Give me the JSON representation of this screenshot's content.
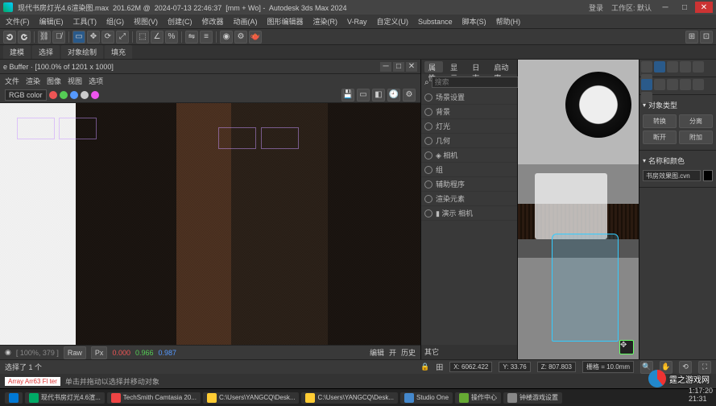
{
  "titlebar": {
    "filename": "现代书房灯光4.6渲染图.max",
    "filesize": "201.62M",
    "timestamp": "2024-07-13 22:46:37",
    "units": "[mm + Wo]",
    "app": "Autodesk 3ds Max 2024",
    "search_placeholder": "登录",
    "workspace": "工作区: 默认"
  },
  "menu": [
    "文件(F)",
    "编辑(E)",
    "工具(T)",
    "组(G)",
    "视图(V)",
    "创建(C)",
    "修改器",
    "动画(A)",
    "图形编辑器",
    "渲染(R)",
    "V-Ray",
    "自定义(U)",
    "Substance",
    "脚本(S)",
    "帮助(H)"
  ],
  "tabs": [
    "建模",
    "选择",
    "对象绘制",
    "填充"
  ],
  "framebuffer": {
    "window_title": "e Buffer",
    "zoom": "[100.0% of 1201 x 1000]",
    "menu": [
      "文件",
      "渲染",
      "图像",
      "视图",
      "选项"
    ],
    "channel": "RGB color",
    "status": {
      "coords": "[ 100%, 379 ]",
      "btn_raw": "Raw",
      "btn_px": "Px",
      "r": "0.000",
      "g": "0.966",
      "b": "0.987",
      "extra1": "编辑",
      "extra2": "开",
      "extra3": "历史"
    }
  },
  "scene_panel": {
    "tabs": [
      "属性",
      "显示",
      "日志",
      "启动率"
    ],
    "filter_placeholder": "搜索",
    "layers": [
      {
        "name": "场景设置",
        "visible": true
      },
      {
        "name": "背景",
        "visible": true
      },
      {
        "name": "灯光",
        "visible": true
      },
      {
        "name": "几何",
        "visible": true
      },
      {
        "name": "◈ 相机",
        "visible": true
      },
      {
        "name": "组",
        "visible": true
      },
      {
        "name": "辅助程序",
        "visible": true
      },
      {
        "name": "渲染元素",
        "visible": true
      },
      {
        "name": "▮ 演示  相机",
        "visible": true
      }
    ],
    "footer": "其它"
  },
  "cmd_panel": {
    "section1": "对象类型",
    "btn_convert": "转换",
    "btn_split": "分离",
    "btn_detach": "断开",
    "btn_attach": "附加",
    "section2": "名称和颜色",
    "name_value": "书房效果图.cvn"
  },
  "status": {
    "sel_count": "选择了 1 个",
    "hint": "单击并拖动以选择并移动对象",
    "lock_icon": "🔒",
    "grid_icon": "田",
    "coords": {
      "x": "X: 6062.422",
      "y": "Y: 33.76",
      "z": "Z: 807.803"
    },
    "grid": "栅格 = 10.0mm",
    "maxscript": "Array Arr63 Fl ter",
    "time": "1:17:20",
    "date": "21:31"
  },
  "taskbar": {
    "apps": [
      {
        "icon": "#0078d4",
        "label": ""
      },
      {
        "icon": "#0a6",
        "label": "现代书房灯光4.6渲..."
      },
      {
        "icon": "#e44",
        "label": "TechSmith Camtasia 20..."
      },
      {
        "icon": "#fc3",
        "label": "C:\\Users\\YANGCQ\\Desk..."
      },
      {
        "icon": "#fc3",
        "label": "C:\\Users\\YANGCQ\\Desk..."
      },
      {
        "icon": "#48c",
        "label": "Studio One"
      },
      {
        "icon": "#6a3",
        "label": "操作中心"
      },
      {
        "icon": "#888",
        "label": "钟楼游戏设置"
      }
    ]
  },
  "watermark": "霆之游戏网"
}
